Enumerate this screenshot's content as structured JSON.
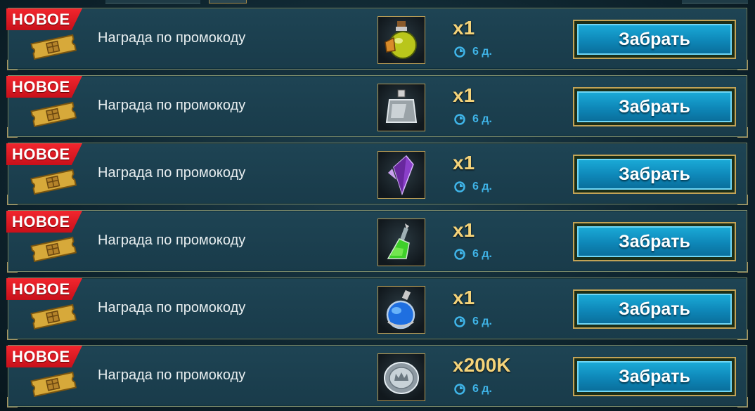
{
  "rewards": [
    {
      "badge": "НОВОЕ",
      "label": "Награда по промокоду",
      "item_icon": "yellow-potion-icon",
      "quantity": "x1",
      "timer": "6 д.",
      "button": "Забрать"
    },
    {
      "badge": "НОВОЕ",
      "label": "Награда по промокоду",
      "item_icon": "silver-flask-icon",
      "quantity": "x1",
      "timer": "6 д.",
      "button": "Забрать"
    },
    {
      "badge": "НОВОЕ",
      "label": "Награда по промокоду",
      "item_icon": "purple-crystal-icon",
      "quantity": "x1",
      "timer": "6 д.",
      "button": "Забрать"
    },
    {
      "badge": "НОВОЕ",
      "label": "Награда по промокоду",
      "item_icon": "green-potion-icon",
      "quantity": "x1",
      "timer": "6 д.",
      "button": "Забрать"
    },
    {
      "badge": "НОВОЕ",
      "label": "Награда по промокоду",
      "item_icon": "blue-potion-icon",
      "quantity": "x1",
      "timer": "6 д.",
      "button": "Забрать"
    },
    {
      "badge": "НОВОЕ",
      "label": "Награда по промокоду",
      "item_icon": "silver-coin-icon",
      "quantity": "x200K",
      "timer": "6 д.",
      "button": "Забрать"
    }
  ],
  "colors": {
    "badge": "#e81c25",
    "quantity": "#f4d37a",
    "timer": "#3fb4e8",
    "button": "#129bc8",
    "frame": "#b59a55"
  }
}
